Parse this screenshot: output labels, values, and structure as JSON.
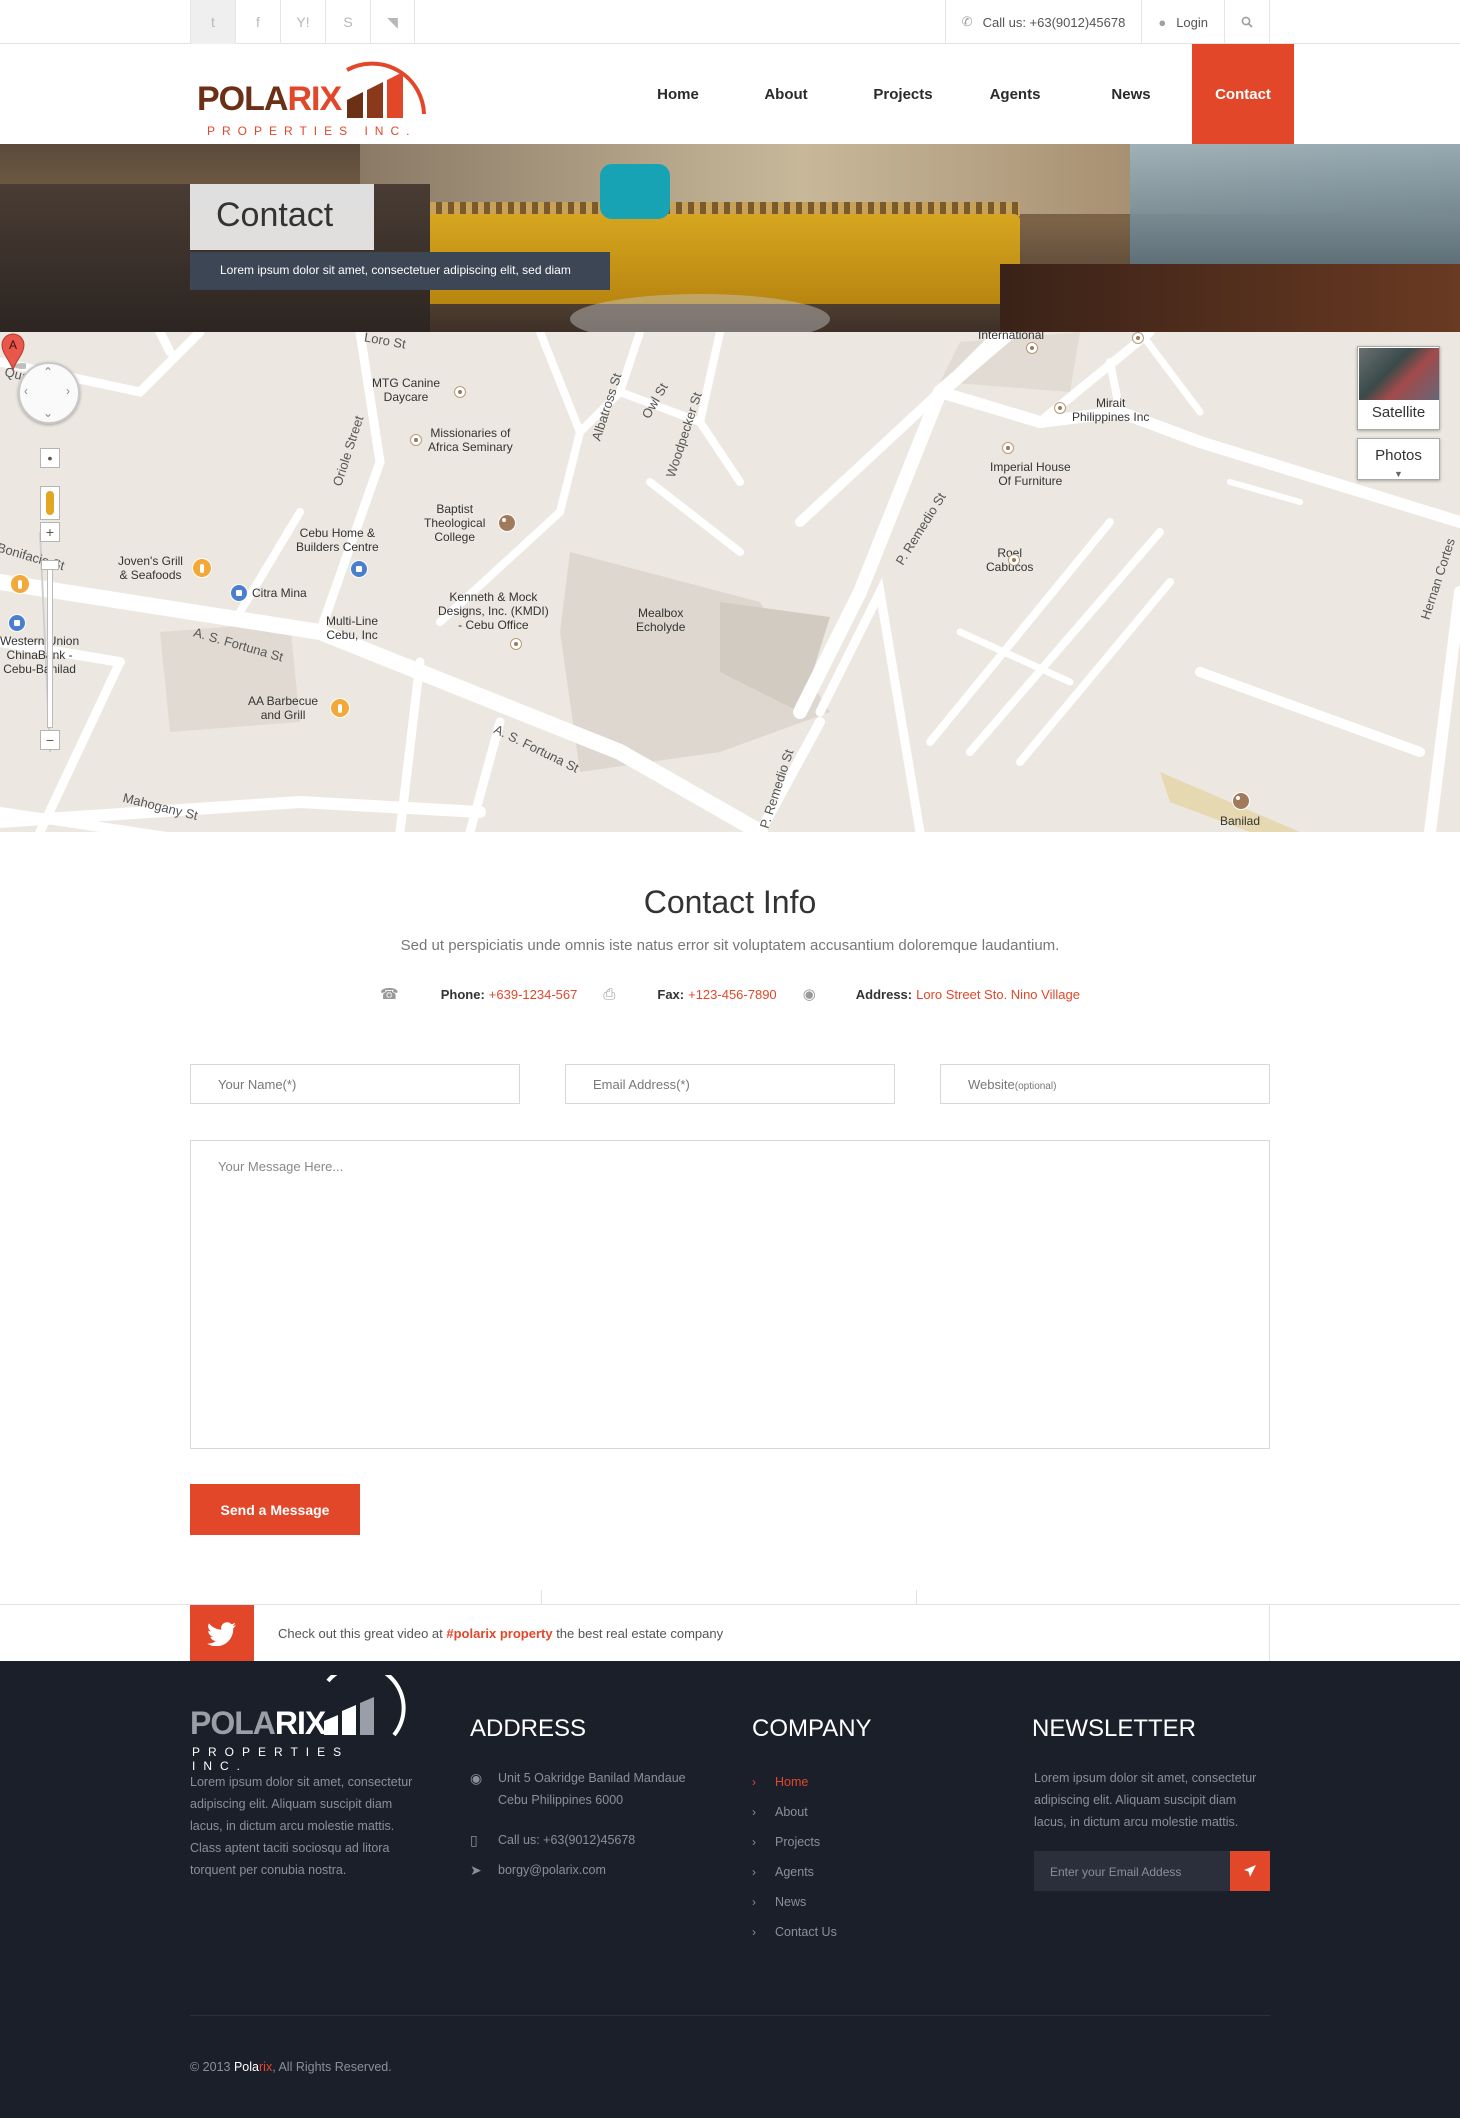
{
  "topbar": {
    "social": [
      {
        "icon": "twitter-icon",
        "glyph": "t"
      },
      {
        "icon": "facebook-icon",
        "glyph": "f"
      },
      {
        "icon": "yahoo-icon",
        "glyph": "Y!"
      },
      {
        "icon": "skype-icon",
        "glyph": "S"
      },
      {
        "icon": "rss-icon",
        "glyph": "◥"
      }
    ],
    "call_label": "Call us: +63(9012)45678",
    "login_label": "Login"
  },
  "logo": {
    "word_a": "POLA",
    "word_b": "RIX",
    "sub": "PROPERTIES INC."
  },
  "nav": [
    {
      "label": "Home",
      "active": false
    },
    {
      "label": "About",
      "active": false
    },
    {
      "label": "Projects",
      "active": false
    },
    {
      "label": "Agents",
      "active": false
    },
    {
      "label": "News",
      "active": false
    },
    {
      "label": "Contact",
      "active": true
    }
  ],
  "banner": {
    "title": "Contact",
    "subtitle": "Lorem ipsum dolor sit amet, consectetuer adipiscing elit, sed diam"
  },
  "map": {
    "type_satellite": "Satellite",
    "type_photos": "Photos",
    "marker_label": "A",
    "labels": {
      "mtg": "MTG Canine\nDaycare",
      "missionaries": "Missionaries of\nAfrica Seminary",
      "baptist": "Baptist\nTheological\nCollege",
      "cebu_home": "Cebu Home &\nBuilders Centre",
      "jovens": "Joven's Grill\n& Seafoods",
      "citra": "Citra Mina",
      "kenneth": "Kenneth & Mock\nDesigns, Inc. (KMDI)\n- Cebu Office",
      "multiline": "Multi-Line\nCebu, Inc",
      "western": "Western Union\nChinaBank -\nCebu-Banilad",
      "aa": "AA Barbecue\nand Grill",
      "mealbox": "Mealbox\nEcholyde",
      "international": "International",
      "mirait": "Mirait\nPhilippines Inc",
      "imperial": "Imperial House\nOf Furniture",
      "roel": "Roel\nCabucos",
      "banilad": "Banilad",
      "fortuna1": "A. S. Fortuna St",
      "fortuna2": "A. S. Fortuna St",
      "mahogany": "Mahogany St",
      "oriole": "Oriole Street",
      "albatross": "Albatross St",
      "owl": "Owl St",
      "woodpecker": "Woodpecker St",
      "premedio1": "P. Remedio St",
      "premedio2": "P. Remedio St",
      "hernan": "Hernan Cortes",
      "bonifacio": "Bonifacio St",
      "quarry": "Quarry Rd",
      "loro": "Loro St"
    }
  },
  "contact_info": {
    "title": "Contact Info",
    "lead": "Sed ut perspiciatis unde omnis iste natus error sit voluptatem accusantium doloremque laudantium.",
    "phone_label": "Phone:",
    "phone": "+639-1234-567",
    "fax_label": "Fax:",
    "fax": "+123-456-7890",
    "address_label": "Address:",
    "address": "Loro Street Sto. Nino Village"
  },
  "form": {
    "name_placeholder": "Your Name(*)",
    "email_placeholder": "Email Address(*)",
    "website_placeholder": "Website",
    "website_optional": "(optional)",
    "message_placeholder": "Your Message Here...",
    "send_label": "Send a Message"
  },
  "twitter": {
    "text_before": "Check out this great video at ",
    "hashtag": "#polarix property",
    "text_after": " the best real estate company"
  },
  "footer": {
    "logo_a": "POLA",
    "logo_b": "RIX",
    "logo_sub": "PROPERTIES INC.",
    "about": "Lorem ipsum dolor sit amet, consectetur adipiscing elit. Aliquam suscipit diam lacus, in dictum arcu molestie mattis. Class aptent taciti sociosqu ad litora torquent per conubia nostra.",
    "address_title": "ADDRESS",
    "address_lines": "Unit 5 Oakridge Banilad Mandaue\nCebu Philippines 6000",
    "phone": "Call us: +63(9012)45678",
    "email": "borgy@polarix.com",
    "company_title": "COMPANY",
    "company_links": [
      {
        "label": "Home",
        "active": true
      },
      {
        "label": "About",
        "active": false
      },
      {
        "label": "Projects",
        "active": false
      },
      {
        "label": "Agents",
        "active": false
      },
      {
        "label": "News",
        "active": false
      },
      {
        "label": "Contact Us",
        "active": false
      }
    ],
    "newsletter_title": "NEWSLETTER",
    "newsletter_text": "Lorem ipsum dolor sit amet, consectetur adipiscing elit. Aliquam suscipit diam lacus, in dictum arcu molestie mattis.",
    "email_placeholder": "Enter your Email Addess",
    "copyright_pre": "© 2013 ",
    "copyright_brand_a": "Pola",
    "copyright_brand_b": "rix",
    "copyright_post": ", All Rights Reserved."
  },
  "colors": {
    "accent": "#e2472a",
    "dark": "#1b1f2a",
    "banner_label": "#3d4654"
  }
}
